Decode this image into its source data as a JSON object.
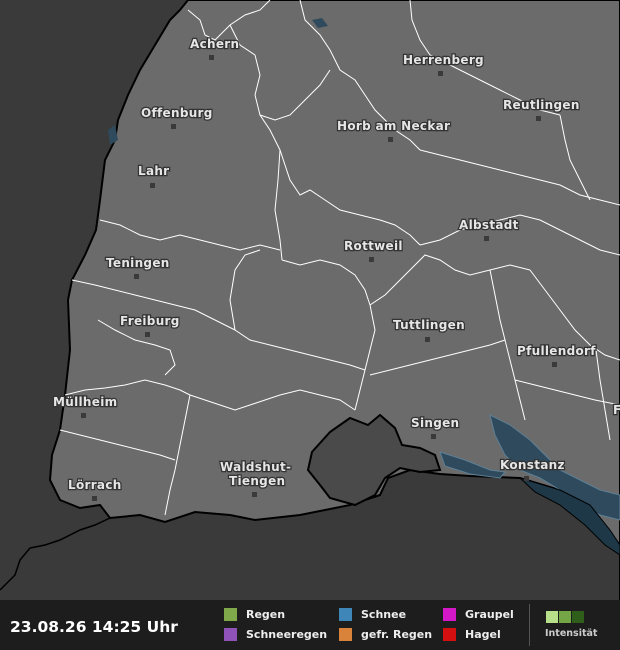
{
  "map": {
    "cities": [
      {
        "name": "Achern"
      },
      {
        "name": "Herrenberg"
      },
      {
        "name": "Offenburg"
      },
      {
        "name": "Reutlingen"
      },
      {
        "name": "Horb am Neckar"
      },
      {
        "name": "Lahr"
      },
      {
        "name": "Albstadt"
      },
      {
        "name": "Rottweil"
      },
      {
        "name": "Teningen"
      },
      {
        "name": "Freiburg"
      },
      {
        "name": "Tuttlingen"
      },
      {
        "name": "Pfullendorf"
      },
      {
        "name": "Müllheim"
      },
      {
        "name": "Singen"
      },
      {
        "name": "Waldshut-",
        "name2": "Tiengen"
      },
      {
        "name": "Konstanz"
      },
      {
        "name": "Lörrach"
      },
      {
        "name": "F"
      }
    ],
    "colors": {
      "background": "#3a3a3a",
      "region": "#6b6b6b",
      "region_dark": "#4a4a4a",
      "water": "#2e4a5c",
      "borders": "#ffffff"
    }
  },
  "footer": {
    "timestamp": "23.08.26 14:25 Uhr",
    "legend": [
      {
        "label": "Regen",
        "color": "#7fa84a"
      },
      {
        "label": "Schneeregen",
        "color": "#8e52b8"
      },
      {
        "label": "Schnee",
        "color": "#3f86b8"
      },
      {
        "label": "gefr. Regen",
        "color": "#d9823a"
      },
      {
        "label": "Graupel",
        "color": "#d418c8"
      },
      {
        "label": "Hagel",
        "color": "#d40f0f"
      }
    ],
    "intensity_label": "Intensität",
    "intensity_colors": [
      "#b8e08a",
      "#74a645",
      "#2f5e1a"
    ]
  }
}
